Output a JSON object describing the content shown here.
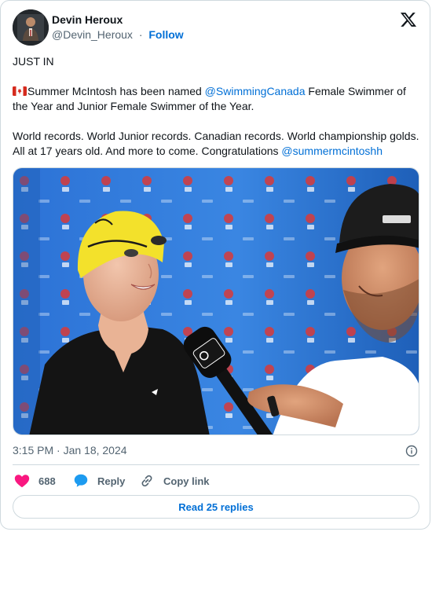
{
  "author": {
    "display_name": "Devin Heroux",
    "handle": "@Devin_Heroux",
    "separator": "·",
    "follow_label": "Follow"
  },
  "tweet": {
    "line1": "JUST IN",
    "line2_before": "Summer McIntosh has been named ",
    "line2_mention": "@SwimmingCanada",
    "line2_after": " Female Swimmer of the Year and Junior Female Swimmer of the Year.",
    "line3_before": "World records. World Junior records. Canadian records. World championship golds. All at 17 years old. And more to come. Congratulations ",
    "line3_mention": "@summermcintoshh"
  },
  "meta": {
    "timestamp": "3:15 PM · Jan 18, 2024"
  },
  "actions": {
    "like_count": "688",
    "reply_label": "Reply",
    "copy_label": "Copy link"
  },
  "read_replies_label": "Read 25 replies",
  "colors": {
    "link": "#006fd6",
    "secondary_text": "#536471",
    "like_red": "#f91880",
    "reply_blue": "#1d9bf0",
    "border": "#cfd9de",
    "swim_cap_yellow": "#f3e12b",
    "backdrop_blue": "#2a6fd1"
  },
  "icons": {
    "logo": "x-logo-icon",
    "info": "info-icon",
    "like": "heart-icon",
    "reply": "speech-bubble-icon",
    "copy": "link-icon",
    "flag": "canada-flag-icon"
  }
}
